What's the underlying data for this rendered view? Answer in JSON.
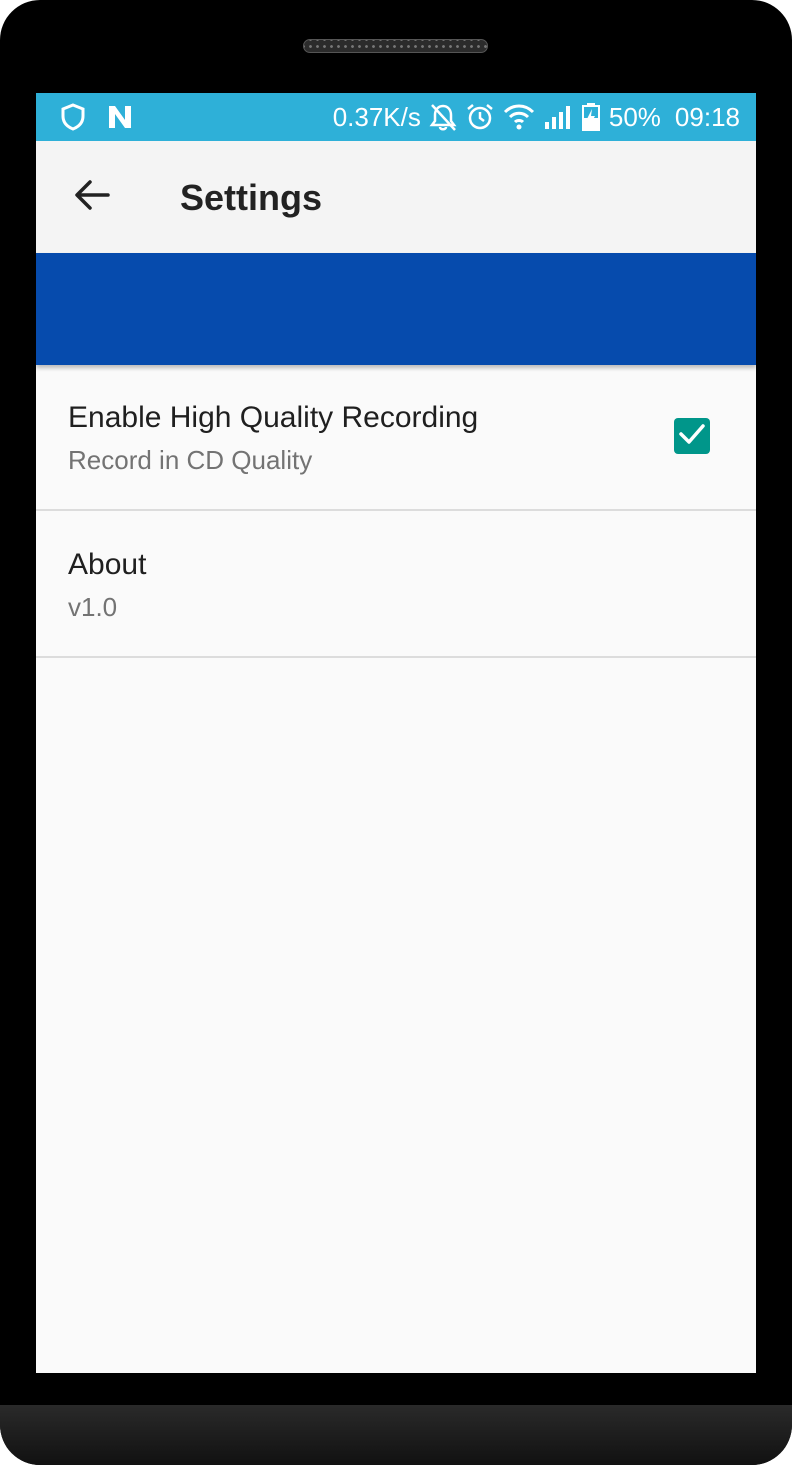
{
  "status_bar": {
    "net_speed": "0.37K/s",
    "battery": "50%",
    "time": "09:18",
    "icons": [
      "shield-icon",
      "n-logo-icon",
      "muted-bell-icon",
      "alarm-icon",
      "wifi-icon",
      "signal-icon",
      "battery-icon"
    ]
  },
  "app_bar": {
    "title": "Settings",
    "back_icon": "arrow-back-icon"
  },
  "colors": {
    "status_bar": "#2eb0d8",
    "banner": "#064bad",
    "checkbox": "#00968a"
  },
  "preferences": [
    {
      "title": "Enable High Quality Recording",
      "summary": "Record in CD Quality",
      "checked": true
    },
    {
      "title": "About",
      "summary": "v1.0"
    }
  ]
}
